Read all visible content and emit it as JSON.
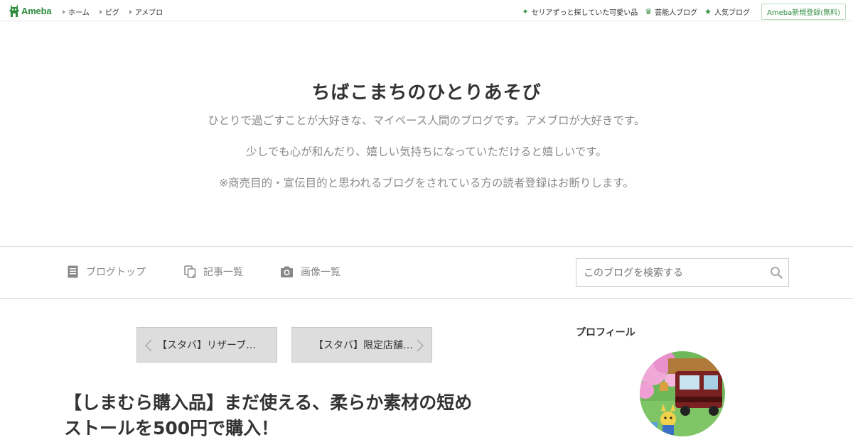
{
  "global_header": {
    "logo_text": "Ameba",
    "nav": [
      {
        "label": "ホーム"
      },
      {
        "label": "ピグ"
      },
      {
        "label": "アメブロ"
      }
    ],
    "right_links": [
      {
        "label": "セリアずっと探していた可愛い品",
        "icon": "sparkle-icon"
      },
      {
        "label": "芸能人ブログ",
        "icon": "crown-icon"
      },
      {
        "label": "人気ブログ",
        "icon": "star-icon"
      }
    ],
    "signup_label": "Ameba新規登録(無料)"
  },
  "blog": {
    "title": "ちばこまちのひとりあそび",
    "description": [
      "ひとりで過ごすことが大好きな、マイペース人間のブログです。アメブロが大好きです。",
      "少しでも心が和んだり、嬉しい気持ちになっていただけると嬉しいです。",
      "※商売目的・宣伝目的と思われるブログをされている方の読者登録はお断りします。"
    ]
  },
  "blog_nav": {
    "items": [
      {
        "label": "ブログトップ",
        "icon": "document-icon"
      },
      {
        "label": "記事一覧",
        "icon": "copy-icon"
      },
      {
        "label": "画像一覧",
        "icon": "camera-icon"
      }
    ],
    "search_placeholder": "このブログを検索する"
  },
  "pager": {
    "prev_label": "【スタバ】リザーブ…",
    "next_label": "【スタバ】限定店舗…"
  },
  "article": {
    "title_line1": "【しまむら購入品】まだ使える、柔らか素材の短め",
    "title_line2": "ストールを500円で購入！"
  },
  "sidebar": {
    "profile_heading": "プロフィール"
  },
  "colors": {
    "brand_green": "#2d8c3c",
    "pager_bg": "#dddddd",
    "desc_gray": "#8a8a8a"
  }
}
